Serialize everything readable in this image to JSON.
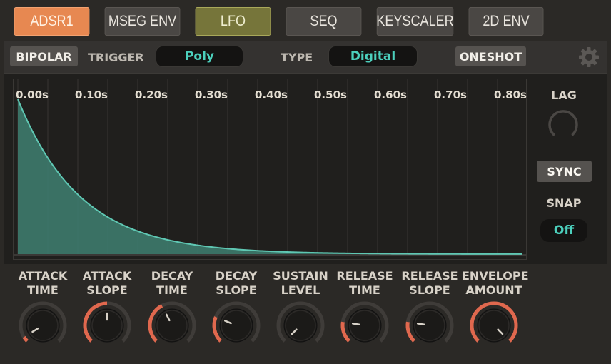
{
  "tabs": [
    {
      "label": "ADSR1",
      "state": "active"
    },
    {
      "label": "MSEG ENV",
      "state": "normal"
    },
    {
      "label": "LFO",
      "state": "highlight"
    },
    {
      "label": "SEQ",
      "state": "normal"
    },
    {
      "label": "KEYSCALER",
      "state": "normal"
    },
    {
      "label": "2D ENV",
      "state": "normal"
    }
  ],
  "toolbar": {
    "bipolar_label": "BIPOLAR",
    "trigger_label": "TRIGGER",
    "trigger_value": "Poly",
    "type_label": "TYPE",
    "type_value": "Digital",
    "oneshot_label": "ONESHOT",
    "settings_icon": "gear-icon"
  },
  "graph": {
    "time_ticks": [
      "0.00s",
      "0.10s",
      "0.20s",
      "0.30s",
      "0.40s",
      "0.50s",
      "0.60s",
      "0.70s",
      "0.80s"
    ],
    "curve_color": "#5fc7b3",
    "fill_color": "#3d7a6d"
  },
  "side": {
    "lag_label": "LAG",
    "sync_label": "SYNC",
    "snap_label": "SNAP",
    "snap_value": "Off"
  },
  "knobs": [
    {
      "line1": "ATTACK",
      "line2": "TIME",
      "value": 0.05
    },
    {
      "line1": "ATTACK",
      "line2": "SLOPE",
      "value": 0.5
    },
    {
      "line1": "DECAY",
      "line2": "TIME",
      "value": 0.4
    },
    {
      "line1": "DECAY",
      "line2": "SLOPE",
      "value": 0.25
    },
    {
      "line1": "SUSTAIN",
      "line2": "LEVEL",
      "value": 0.0
    },
    {
      "line1": "RELEASE",
      "line2": "TIME",
      "value": 0.2
    },
    {
      "line1": "RELEASE",
      "line2": "SLOPE",
      "value": 0.2
    },
    {
      "line1": "ENVELOPE",
      "line2": "AMOUNT",
      "value": 1.0
    }
  ],
  "colors": {
    "accent": "#e78851",
    "arc": "#e0684e",
    "teal": "#4cd0bd"
  }
}
